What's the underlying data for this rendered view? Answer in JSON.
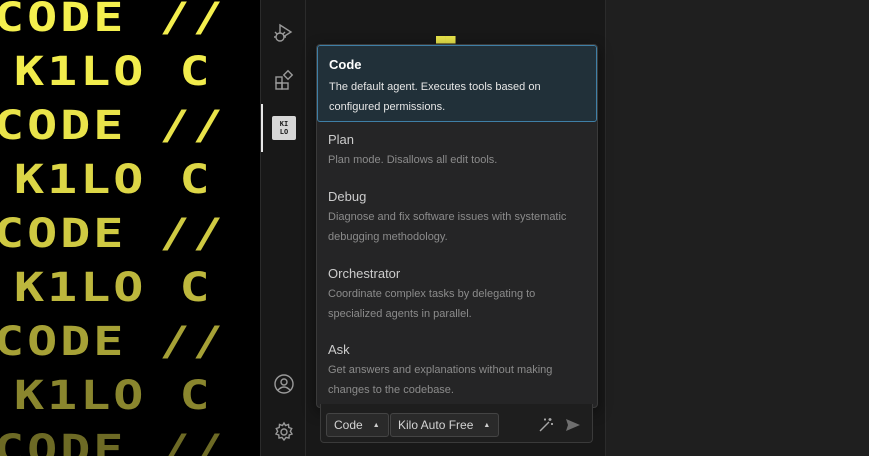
{
  "poster": {
    "lines": [
      "CODE // C",
      "K1LO C",
      "CODE // C",
      "K1LO C",
      "CODE // C",
      "K1LO C",
      "CODE // C",
      "K1LO C",
      "CODE // C"
    ],
    "colors": [
      "#f4ef4e",
      "#f1ec4c",
      "#e9e34a",
      "#dcd646",
      "#cfc942",
      "#bdb73d",
      "#a6a136",
      "#8a862e",
      "#6d6a25"
    ]
  },
  "activity_bar": {
    "icons": [
      "run-debug-icon",
      "extensions-icon",
      "kilo-code-icon",
      "account-icon",
      "settings-icon"
    ],
    "kilo_badge": "KI LO"
  },
  "agent_menu": {
    "options": [
      {
        "title": "Code",
        "description": "The default agent. Executes tools based on configured permissions.",
        "selected": true
      },
      {
        "title": "Plan",
        "description": "Plan mode. Disallows all edit tools.",
        "selected": false
      },
      {
        "title": "Debug",
        "description": "Diagnose and fix software issues with systematic debugging methodology.",
        "selected": false
      },
      {
        "title": "Orchestrator",
        "description": "Coordinate complex tasks by delegating to specialized agents in parallel.",
        "selected": false
      },
      {
        "title": "Ask",
        "description": "Get answers and explanations without making changes to the codebase.",
        "selected": false
      }
    ]
  },
  "input_bar": {
    "mode_label": "Code",
    "model_label": "Kilo Auto Free"
  },
  "colors": {
    "accent_border": "#3f7fa6",
    "selected_bg": "#213039",
    "poster_yellow": "#f4ef4e"
  }
}
